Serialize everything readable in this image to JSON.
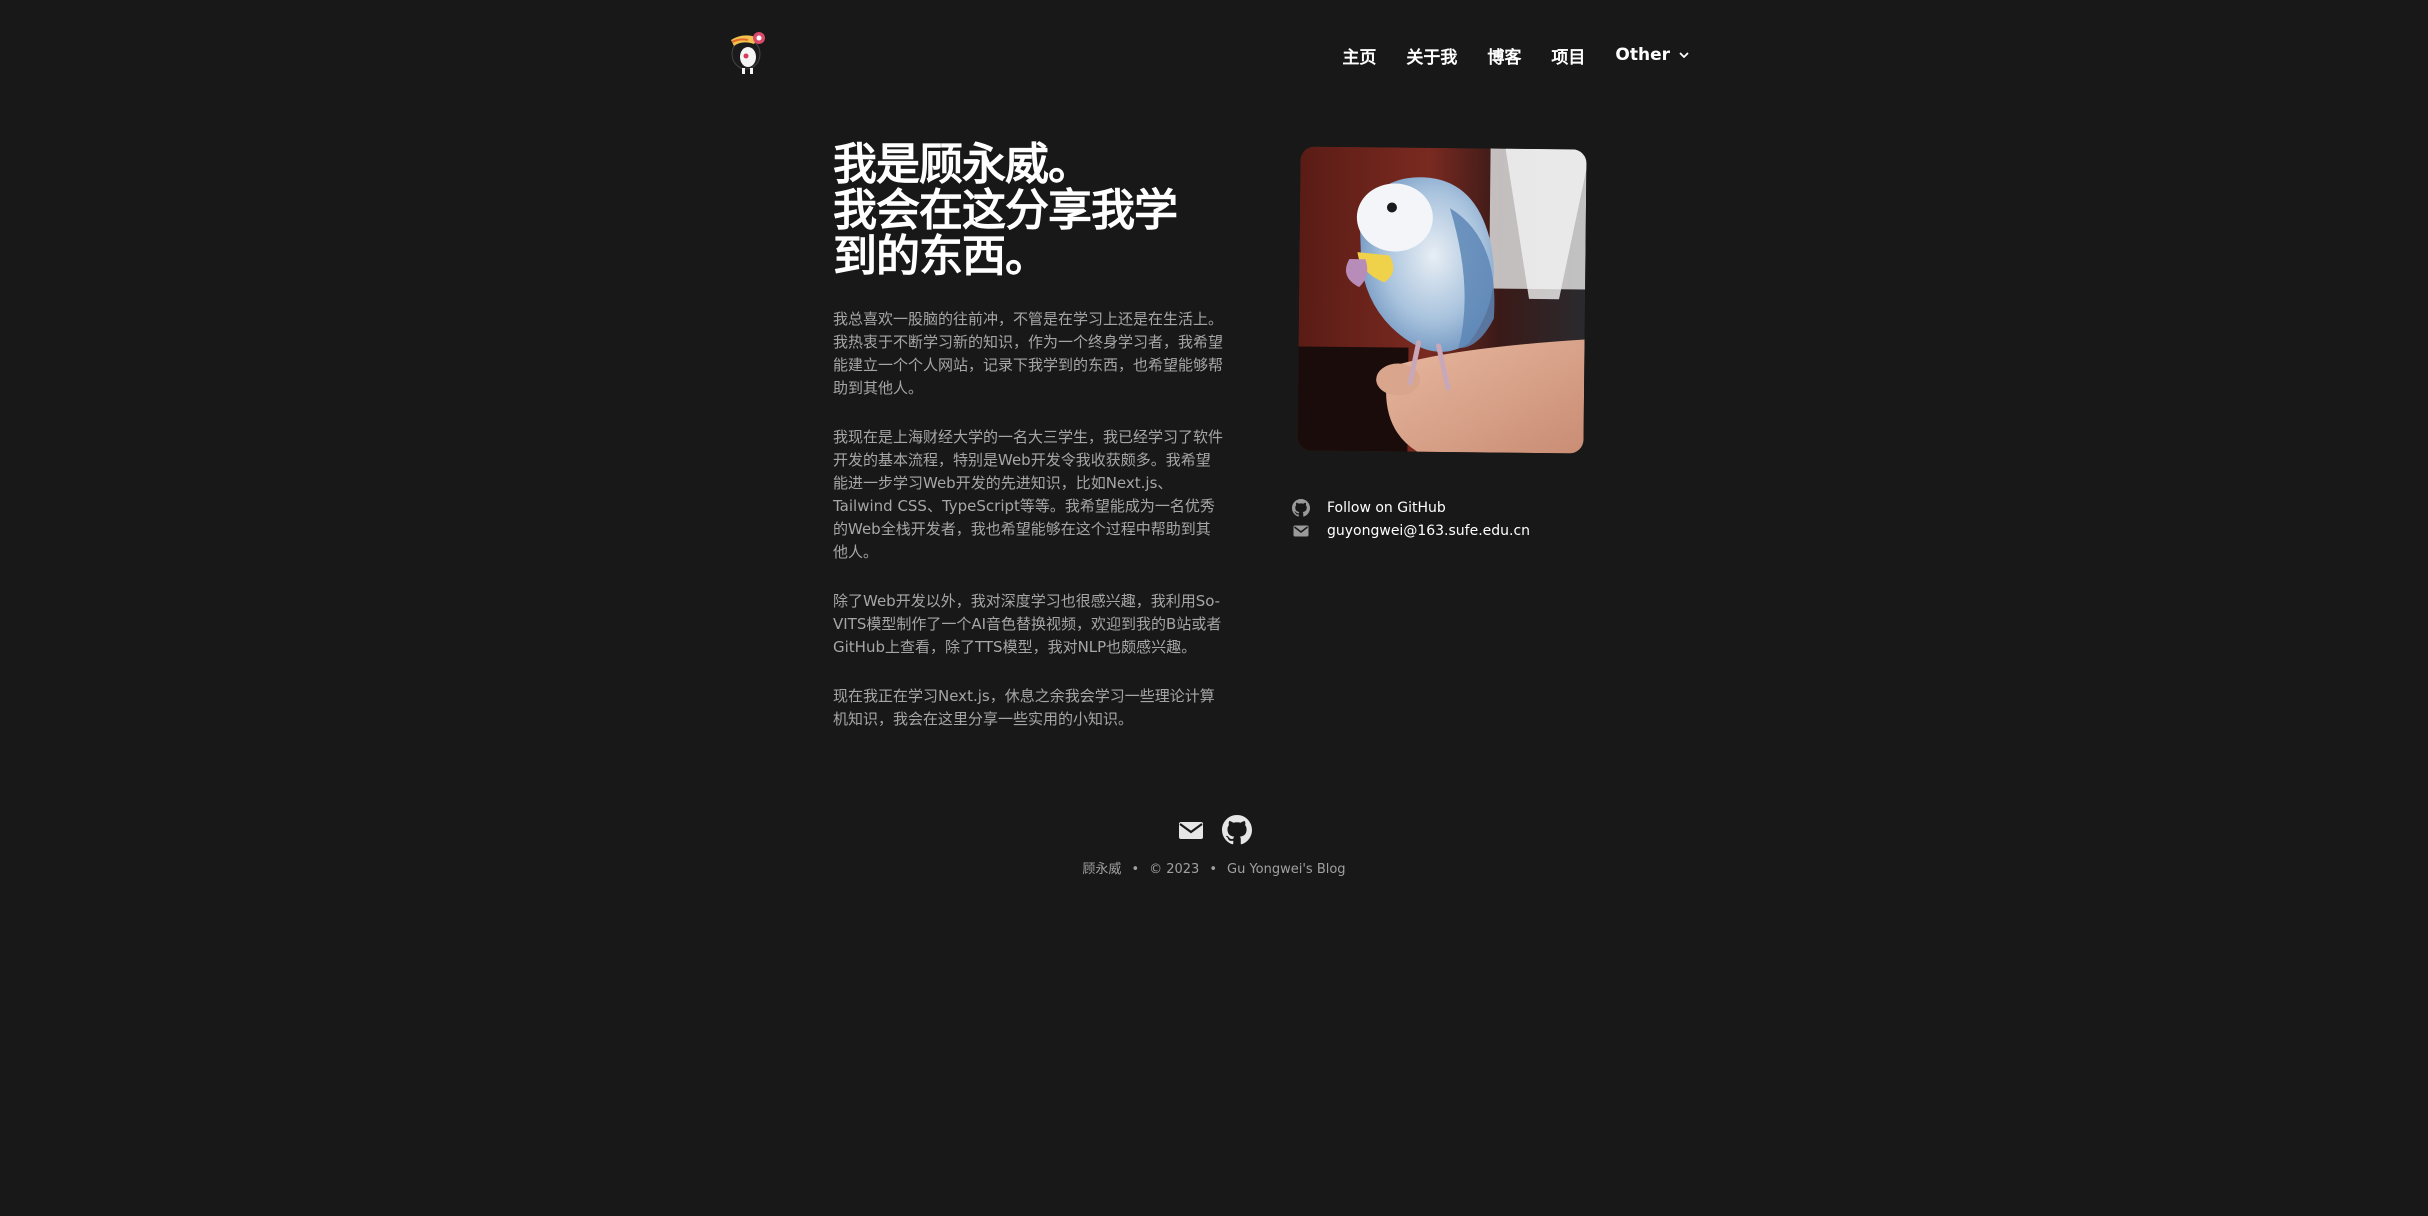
{
  "nav": {
    "items": [
      "主页",
      "关于我",
      "博客",
      "项目"
    ],
    "other_label": "Other"
  },
  "hero": {
    "heading": "我是顾永威。\n我会在这分享我学\n到的东西。",
    "paragraphs": [
      "我总喜欢一股脑的往前冲，不管是在学习上还是在生活上。我热衷于不断学习新的知识，作为一个终身学习者，我希望能建立一个个人网站，记录下我学到的东西，也希望能够帮助到其他人。",
      "我现在是上海财经大学的一名大三学生，我已经学习了软件开发的基本流程，特别是Web开发令我收获颇多。我希望能进一步学习Web开发的先进知识，比如Next.js、Tailwind CSS、TypeScript等等。我希望能成为一名优秀的Web全栈开发者，我也希望能够在这个过程中帮助到其他人。",
      "除了Web开发以外，我对深度学习也很感兴趣，我利用So-VITS模型制作了一个AI音色替换视频，欢迎到我的B站或者GitHub上查看，除了TTS模型，我对NLP也颇感兴趣。",
      "现在我正在学习Next.js，休息之余我会学习一些理论计算机知识，我会在这里分享一些实用的小知识。"
    ]
  },
  "contacts": {
    "github_label": "Follow on GitHub",
    "email_label": "guyongwei@163.sufe.edu.cn"
  },
  "footer": {
    "author": "顾永威",
    "copyright": "© 2023",
    "site": "Gu Yongwei's Blog"
  },
  "icons": [
    "logo-icon",
    "chevron-down-icon",
    "github-icon",
    "mail-icon"
  ]
}
